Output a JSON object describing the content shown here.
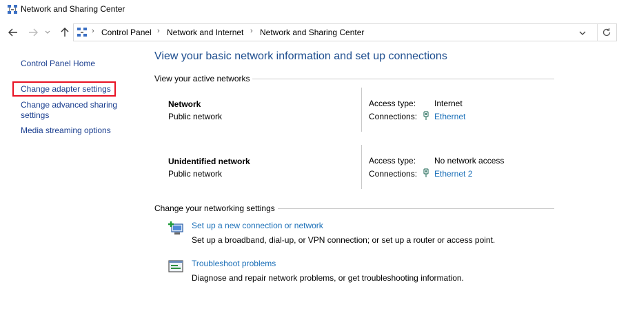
{
  "window": {
    "title": "Network and Sharing Center"
  },
  "address_bar": {
    "crumbs": [
      "Control Panel",
      "Network and Internet",
      "Network and Sharing Center"
    ]
  },
  "sidebar": {
    "items": [
      {
        "label": "Control Panel Home"
      },
      {
        "label": "Change adapter settings"
      },
      {
        "label": "Change advanced sharing"
      },
      {
        "label": "settings"
      },
      {
        "label": "Media streaming options"
      }
    ]
  },
  "main": {
    "heading": "View your basic network information and set up connections",
    "active_networks_label": "View your active networks",
    "networks": [
      {
        "name": "Network",
        "category": "Public network",
        "access_label": "Access type:",
        "access_value": "Internet",
        "connections_label": "Connections:",
        "connection": "Ethernet"
      },
      {
        "name": "Unidentified network",
        "category": "Public network",
        "access_label": "Access type:",
        "access_value": "No network access",
        "connections_label": "Connections:",
        "connection": "Ethernet 2"
      }
    ],
    "settings_label": "Change your networking settings",
    "tasks": [
      {
        "link": "Set up a new connection or network",
        "desc": "Set up a broadband, dial-up, or VPN connection; or set up a router or access point.",
        "icon": "new-connection-icon"
      },
      {
        "link": "Troubleshoot problems",
        "desc": "Diagnose and repair network problems, or get troubleshooting information.",
        "icon": "troubleshoot-icon"
      }
    ]
  },
  "colors": {
    "link": "#1a6fb8",
    "heading": "#1e4e8f",
    "highlight": "#e81123"
  }
}
